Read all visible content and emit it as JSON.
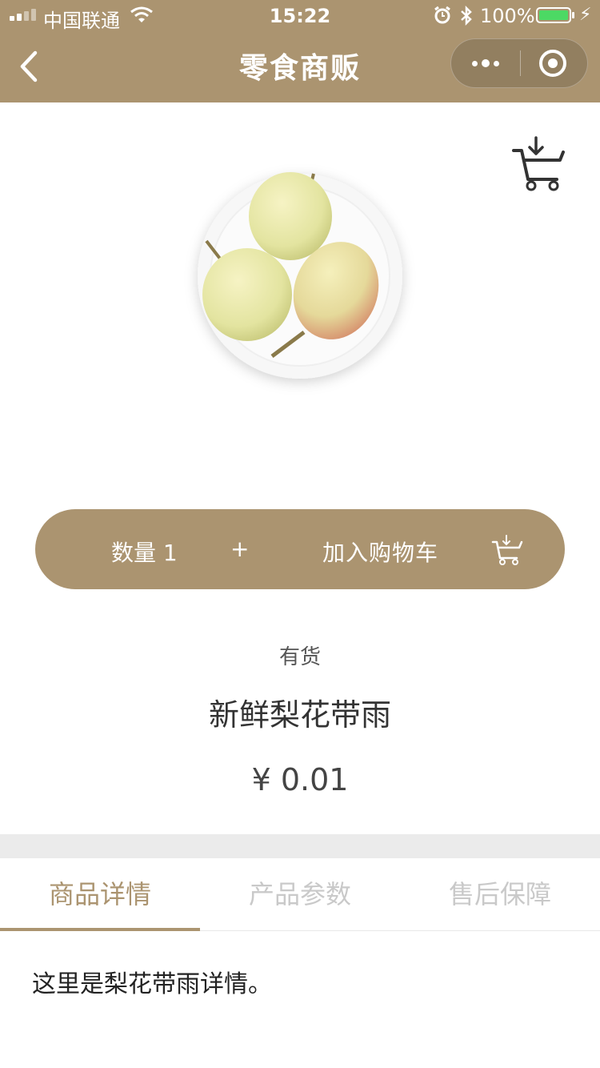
{
  "status_bar": {
    "carrier": "中国联通",
    "time": "15:22",
    "battery": "100%"
  },
  "nav": {
    "title": "零食商贩"
  },
  "action_bar": {
    "quantity_label": "数量 1",
    "plus": "+",
    "add_to_cart": "加入购物车"
  },
  "product": {
    "stock": "有货",
    "name": "新鲜梨花带雨",
    "price": "¥  0.01"
  },
  "tabs": [
    {
      "label": "商品详情",
      "active": true
    },
    {
      "label": "产品参数",
      "active": false
    },
    {
      "label": "售后保障",
      "active": false
    }
  ],
  "detail_text": "这里是梨花带雨详情。",
  "colors": {
    "accent": "#ab9470",
    "battery": "#4cd964"
  }
}
